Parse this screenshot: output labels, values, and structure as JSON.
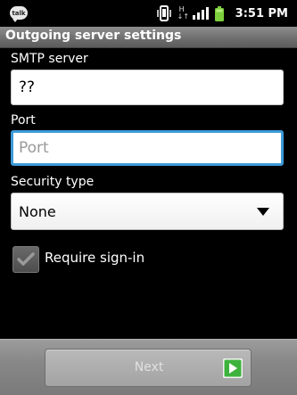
{
  "status_bar": {
    "notification_icon": "talk-icon",
    "notification_text": "talk",
    "network_type": "H",
    "network_arrows": "↓↑",
    "time": "3:51 PM"
  },
  "header": {
    "title": "Outgoing server settings"
  },
  "form": {
    "smtp_server": {
      "label": "SMTP server",
      "value": "??"
    },
    "port": {
      "label": "Port",
      "value": "",
      "placeholder": "Port"
    },
    "security_type": {
      "label": "Security type",
      "selected": "None"
    },
    "require_signin": {
      "label": "Require sign-in",
      "checked": true
    }
  },
  "footer": {
    "next_label": "Next"
  },
  "colors": {
    "focus_border": "#3d9ad8",
    "arrow_green": "#3db33d",
    "title_bar": "#7a7a7a"
  }
}
